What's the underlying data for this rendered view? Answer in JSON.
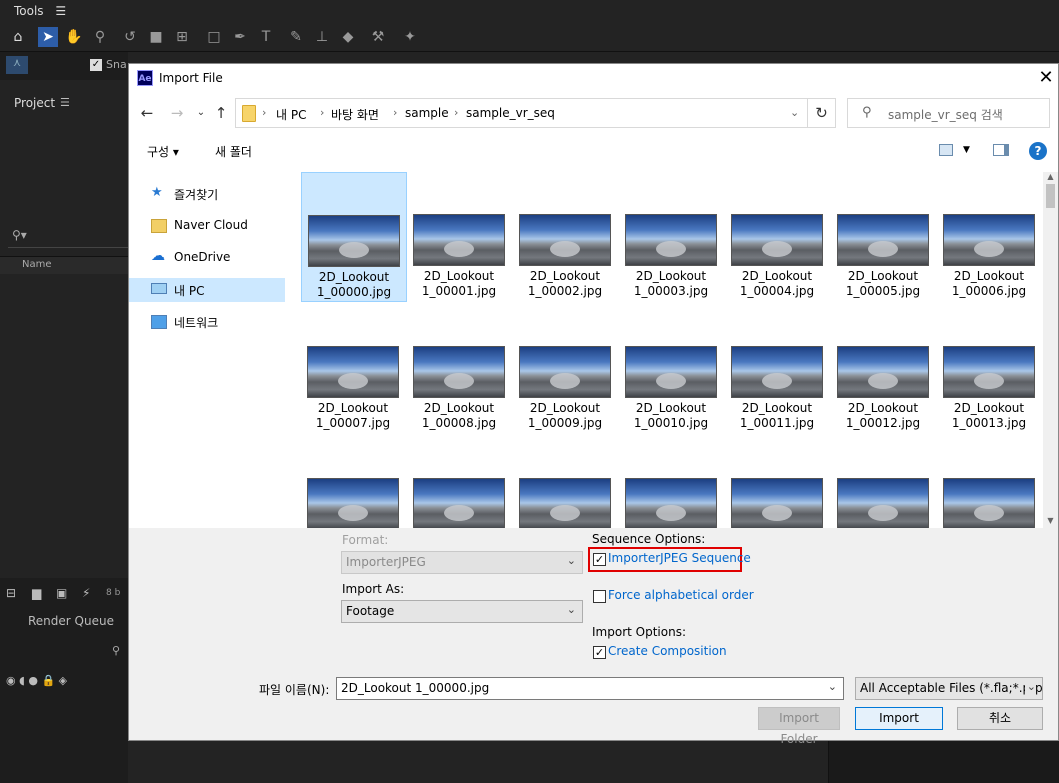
{
  "ae": {
    "tools_label": "Tools",
    "snap_label": "Sna",
    "project_label": "Project",
    "name_col": "Name",
    "render_queue": "Render Queue",
    "bpc": "8 b"
  },
  "dialog": {
    "title": "Import File",
    "app_badge": "Ae",
    "breadcrumbs": [
      "내 PC",
      "바탕 화면",
      "sample",
      "sample_vr_seq"
    ],
    "search_placeholder": "sample_vr_seq 검색",
    "cmd_organize": "구성",
    "cmd_new_folder": "새 폴더",
    "help_icon": "?",
    "sidebar": [
      {
        "label": "즐겨찾기",
        "icon": "star-icon"
      },
      {
        "label": "Naver Cloud",
        "icon": "cloud-folder-icon"
      },
      {
        "label": "OneDrive",
        "icon": "onedrive-icon"
      },
      {
        "label": "내 PC",
        "icon": "pc-icon",
        "selected": true
      },
      {
        "label": "네트워크",
        "icon": "network-icon"
      }
    ],
    "files": [
      {
        "l1": "2D_Lookout",
        "l2": "1_00000.jpg"
      },
      {
        "l1": "2D_Lookout",
        "l2": "1_00001.jpg"
      },
      {
        "l1": "2D_Lookout",
        "l2": "1_00002.jpg"
      },
      {
        "l1": "2D_Lookout",
        "l2": "1_00003.jpg"
      },
      {
        "l1": "2D_Lookout",
        "l2": "1_00004.jpg"
      },
      {
        "l1": "2D_Lookout",
        "l2": "1_00005.jpg"
      },
      {
        "l1": "2D_Lookout",
        "l2": "1_00006.jpg"
      },
      {
        "l1": "2D_Lookout",
        "l2": "1_00007.jpg"
      },
      {
        "l1": "2D_Lookout",
        "l2": "1_00008.jpg"
      },
      {
        "l1": "2D_Lookout",
        "l2": "1_00009.jpg"
      },
      {
        "l1": "2D_Lookout",
        "l2": "1_00010.jpg"
      },
      {
        "l1": "2D_Lookout",
        "l2": "1_00011.jpg"
      },
      {
        "l1": "2D_Lookout",
        "l2": "1_00012.jpg"
      },
      {
        "l1": "2D_Lookout",
        "l2": "1_00013.jpg"
      },
      {
        "l1": "",
        "l2": ""
      },
      {
        "l1": "",
        "l2": ""
      },
      {
        "l1": "",
        "l2": ""
      },
      {
        "l1": "",
        "l2": ""
      },
      {
        "l1": "",
        "l2": ""
      },
      {
        "l1": "",
        "l2": ""
      },
      {
        "l1": "",
        "l2": ""
      }
    ],
    "options": {
      "format_label": "Format:",
      "format_value": "ImporterJPEG",
      "import_as_label": "Import As:",
      "import_as_value": "Footage",
      "sequence_options_label": "Sequence Options:",
      "sequence_checkbox": "ImporterJPEG Sequence",
      "sequence_checked": true,
      "force_alpha": "Force alphabetical order",
      "force_alpha_checked": false,
      "import_options_label": "Import Options:",
      "create_comp": "Create Composition",
      "create_comp_checked": true
    },
    "filename_label": "파일 이름(N):",
    "filename_value": "2D_Lookout 1_00000.jpg",
    "filetype_value": "All Acceptable Files (*.fla;*.prpr",
    "btn_import_folder": "Import Folder",
    "btn_import": "Import",
    "btn_cancel": "취소"
  },
  "colors": {
    "selection": "#cce8ff",
    "link_blue": "#0066cc",
    "highlight_red": "#e00000"
  }
}
